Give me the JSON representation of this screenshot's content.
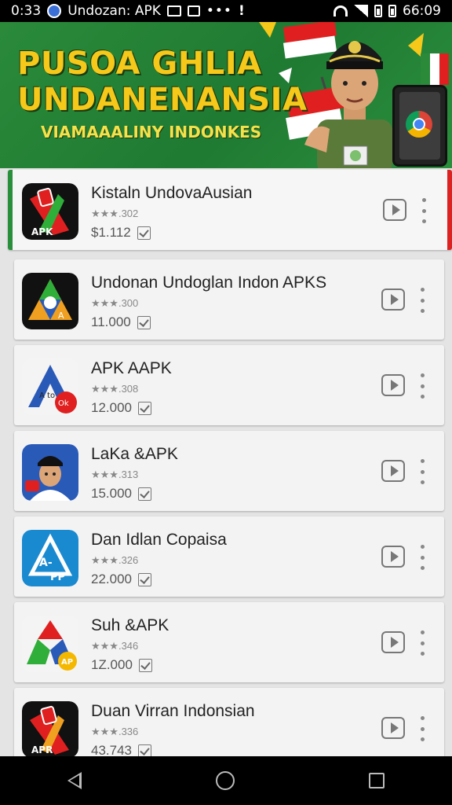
{
  "status_bar": {
    "time_left": "0:33",
    "app_label": "Undozan: APK",
    "dots": "•••",
    "time_right": "66:09"
  },
  "banner": {
    "title_line1": "PUSOA GHLIA",
    "title_line2": "UNDANENANSIA",
    "subtitle": "VIAMAAALINY INDONKES"
  },
  "apps": [
    {
      "name": "Kistaln UndovaAusian",
      "rating": "★★★.302",
      "downloads": "$1.112",
      "icon": "apk-redblack-icon"
    },
    {
      "name": "Undonan Undoglan Indon APKS",
      "rating": "★★★.300",
      "downloads": "11.000",
      "icon": "apk-triangle-icon"
    },
    {
      "name": "APK AAPK",
      "rating": "★★★.308",
      "downloads": "12.000",
      "icon": "apk-blue-a-icon"
    },
    {
      "name": "LaKa &APK",
      "rating": "★★★.313",
      "downloads": "15.000",
      "icon": "apk-person-icon"
    },
    {
      "name": "Dan Idlan Copaisa",
      "rating": "★★★.326",
      "downloads": "22.000",
      "icon": "apk-teal-icon"
    },
    {
      "name": "Suh &APK",
      "rating": "★★★.346",
      "downloads": "1Z.000",
      "icon": "apk-green-a-icon"
    },
    {
      "name": "Duan Virran Indonsian",
      "rating": "★★★.336",
      "downloads": "43.743",
      "icon": "apk-redblack2-icon"
    }
  ],
  "colors": {
    "banner_green": "#2a8a3a",
    "title_yellow": "#f5c81a",
    "accent_red": "#dd2222"
  }
}
